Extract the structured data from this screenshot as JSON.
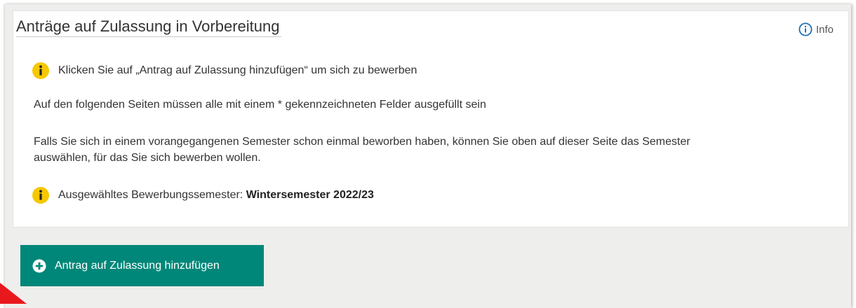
{
  "panel": {
    "title": "Anträge auf Zulassung in Vorbereitung",
    "info_label": "Info"
  },
  "messages": {
    "hint_click": "Klicken Sie auf „Antrag auf Zulassung hinzufügen“ um sich zu bewerben",
    "required_fields": "Auf den folgenden Seiten müssen alle mit einem * gekennzeichneten Felder ausgefüllt sein",
    "previous_semester_line1": "Falls Sie sich in einem vorangegangenen Semester schon einmal beworben haben, können Sie oben auf dieser Seite das Semester",
    "previous_semester_line2": "auswählen, für das Sie sich bewerben wollen.",
    "selected_semester_label": "Ausgewähltes Bewerbungssemester:",
    "selected_semester_value": "Wintersemester 2022/23"
  },
  "actions": {
    "add_application_label": "Antrag auf Zulassung hinzufügen"
  },
  "colors": {
    "primary_button": "#008779",
    "warning_icon": "#f5c800",
    "info_icon": "#1f6fb2",
    "annotation": "#e8181c"
  },
  "icons": {
    "warning": "warning-info-icon",
    "info": "info-circle-icon",
    "add": "plus-circle-icon"
  }
}
